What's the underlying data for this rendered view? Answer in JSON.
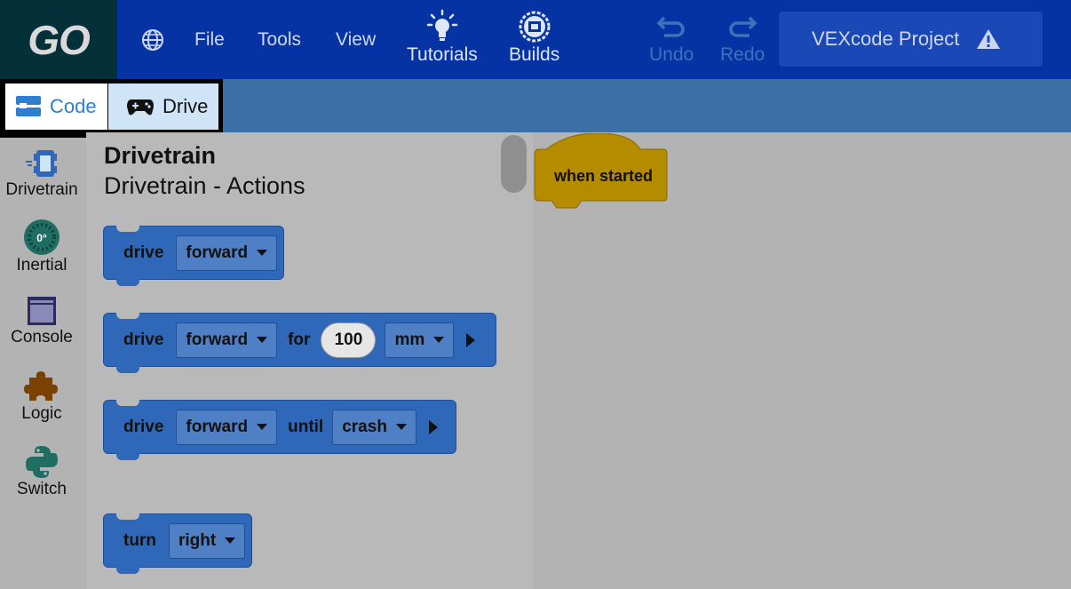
{
  "app": {
    "logo": "GO",
    "menu": [
      "File",
      "Tools",
      "View"
    ],
    "tutorials_label": "Tutorials",
    "builds_label": "Builds",
    "undo_label": "Undo",
    "redo_label": "Redo",
    "project_title": "VEXcode Project"
  },
  "tabs": {
    "code": "Code",
    "drive": "Drive"
  },
  "categories": [
    {
      "label": "Drivetrain",
      "icon": "drivetrain-icon"
    },
    {
      "label": "Inertial",
      "icon": "inertial-icon",
      "badge": "0°"
    },
    {
      "label": "Console",
      "icon": "console-icon"
    },
    {
      "label": "Logic",
      "icon": "puzzle-icon"
    },
    {
      "label": "Switch",
      "icon": "python-icon"
    }
  ],
  "palette": {
    "title": "Drivetrain",
    "subtitle": "Drivetrain - Actions",
    "blocks": [
      {
        "parts": [
          "drive",
          "forward"
        ]
      },
      {
        "parts": [
          "drive",
          "forward",
          "for",
          "100",
          "mm"
        ]
      },
      {
        "parts": [
          "drive",
          "forward",
          "until",
          "crash"
        ]
      },
      {
        "parts": [
          "turn",
          "right"
        ]
      }
    ]
  },
  "workspace": {
    "hat_block": "when started"
  },
  "colors": {
    "topbar": "#0533a3",
    "block": "#2f68b9",
    "hat": "#b58b00"
  }
}
